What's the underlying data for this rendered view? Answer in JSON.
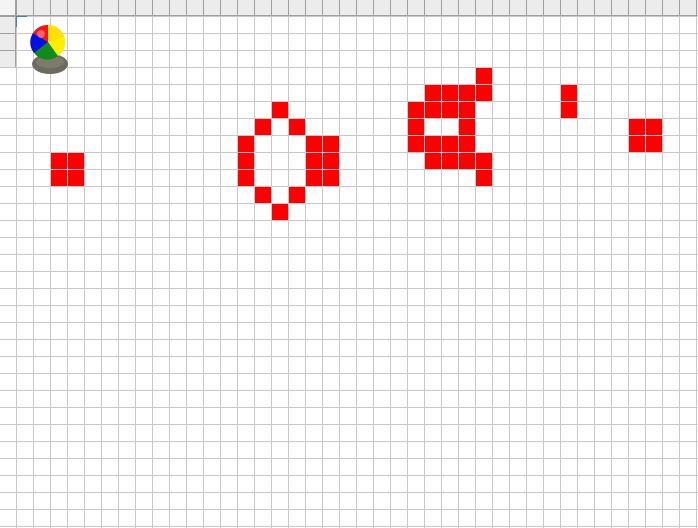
{
  "app": {
    "logo_icon": "beach-ball-icon"
  },
  "grid": {
    "line_color": "#c8c8c8",
    "header_color": "#ececec",
    "live_cell_color": "#ff0000",
    "live_cells": [
      {
        "col": 2,
        "row": 8
      },
      {
        "col": 3,
        "row": 8
      },
      {
        "col": 2,
        "row": 9
      },
      {
        "col": 3,
        "row": 9
      },
      {
        "col": 15,
        "row": 5
      },
      {
        "col": 14,
        "row": 6
      },
      {
        "col": 16,
        "row": 6
      },
      {
        "col": 13,
        "row": 7
      },
      {
        "col": 17,
        "row": 7
      },
      {
        "col": 18,
        "row": 7
      },
      {
        "col": 13,
        "row": 8
      },
      {
        "col": 17,
        "row": 8
      },
      {
        "col": 18,
        "row": 8
      },
      {
        "col": 13,
        "row": 9
      },
      {
        "col": 17,
        "row": 9
      },
      {
        "col": 18,
        "row": 9
      },
      {
        "col": 14,
        "row": 10
      },
      {
        "col": 16,
        "row": 10
      },
      {
        "col": 15,
        "row": 11
      },
      {
        "col": 27,
        "row": 3
      },
      {
        "col": 24,
        "row": 4
      },
      {
        "col": 25,
        "row": 4
      },
      {
        "col": 26,
        "row": 4
      },
      {
        "col": 27,
        "row": 4
      },
      {
        "col": 23,
        "row": 5
      },
      {
        "col": 24,
        "row": 5
      },
      {
        "col": 25,
        "row": 5
      },
      {
        "col": 26,
        "row": 5
      },
      {
        "col": 23,
        "row": 6
      },
      {
        "col": 26,
        "row": 6
      },
      {
        "col": 23,
        "row": 7
      },
      {
        "col": 24,
        "row": 7
      },
      {
        "col": 25,
        "row": 7
      },
      {
        "col": 26,
        "row": 7
      },
      {
        "col": 24,
        "row": 8
      },
      {
        "col": 25,
        "row": 8
      },
      {
        "col": 26,
        "row": 8
      },
      {
        "col": 27,
        "row": 8
      },
      {
        "col": 27,
        "row": 9
      },
      {
        "col": 32,
        "row": 4
      },
      {
        "col": 32,
        "row": 5
      },
      {
        "col": 36,
        "row": 6
      },
      {
        "col": 37,
        "row": 6
      },
      {
        "col": 36,
        "row": 7
      },
      {
        "col": 37,
        "row": 7
      }
    ]
  }
}
